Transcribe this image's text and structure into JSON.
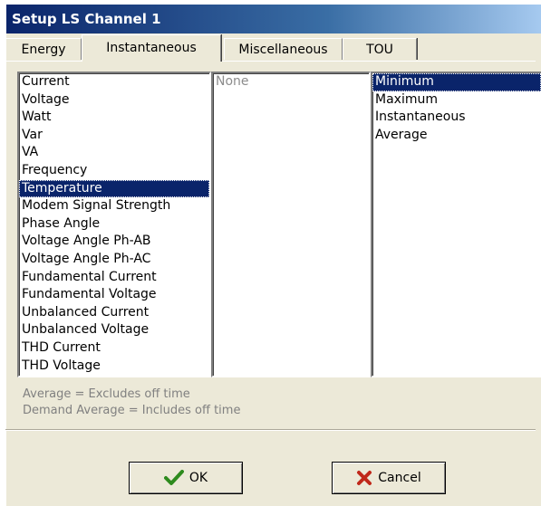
{
  "window": {
    "title": "Setup LS Channel 1"
  },
  "tabs": [
    {
      "label": "Energy"
    },
    {
      "label": "Instantaneous"
    },
    {
      "label": "Miscellaneous"
    },
    {
      "label": "TOU"
    }
  ],
  "active_tab": "Instantaneous",
  "quantity_list": {
    "items": [
      "Current",
      "Voltage",
      "Watt",
      "Var",
      "VA",
      "Frequency",
      "Temperature",
      "Modem Signal Strength",
      "Phase Angle",
      "Voltage Angle Ph-AB",
      "Voltage Angle Ph-AC",
      "Fundamental Current",
      "Fundamental Voltage",
      "Unbalanced Current",
      "Unbalanced Voltage",
      "THD Current",
      "THD Voltage"
    ],
    "selected": "Temperature"
  },
  "phase_list": {
    "items": [
      "None"
    ]
  },
  "type_list": {
    "items": [
      "Minimum",
      "Maximum",
      "Instantaneous",
      "Average"
    ],
    "selected": "Minimum"
  },
  "notes": {
    "line1": "Average = Excludes off time",
    "line2": "Demand Average = Includes off time"
  },
  "buttons": {
    "ok": "OK",
    "cancel": "Cancel"
  },
  "icons": {
    "ok": "checkmark-icon",
    "cancel": "x-icon"
  },
  "colors": {
    "selection": "#0a246a",
    "ok_icon": "#2e8b1e",
    "cancel_icon": "#c0281a"
  }
}
